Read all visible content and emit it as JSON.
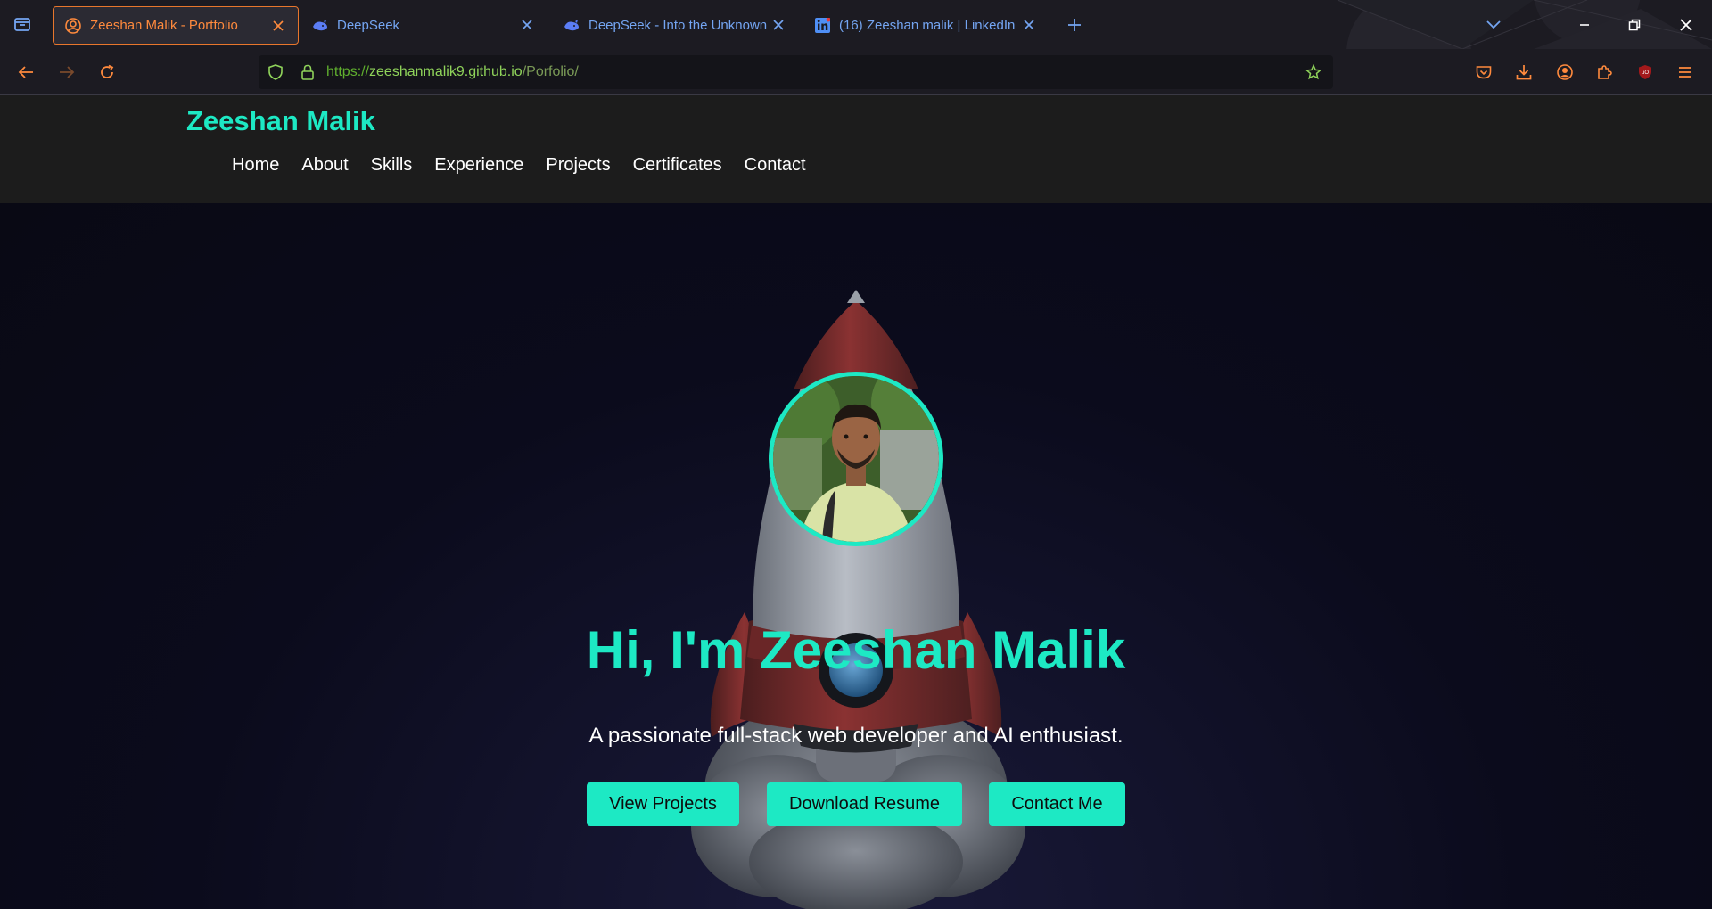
{
  "browser": {
    "tabs": [
      {
        "title": "Zeeshan Malik - Portfolio",
        "favicon": "user-circle-icon",
        "active": true
      },
      {
        "title": "DeepSeek",
        "favicon": "whale-icon",
        "active": false
      },
      {
        "title": "DeepSeek - Into the Unknown",
        "favicon": "whale-icon",
        "active": false
      },
      {
        "title": "(16) Zeeshan malik | LinkedIn",
        "favicon": "linkedin-icon",
        "active": false
      }
    ],
    "url": {
      "scheme": "https://",
      "host": "zeeshanmalik9.github.io",
      "path": "/Porfolio/"
    },
    "colors": {
      "chrome_bg": "#1c1b22",
      "active_tab_accent": "#ff8a3d",
      "tab_text": "#74a5f2"
    }
  },
  "site": {
    "brand": "Zeeshan Malik",
    "nav": [
      "Home",
      "About",
      "Skills",
      "Experience",
      "Projects",
      "Certificates",
      "Contact"
    ],
    "hero": {
      "title": "Hi, I'm Zeeshan Malik",
      "subtitle": "A passionate full-stack web developer and AI enthusiast.",
      "buttons": [
        "View Projects",
        "Download Resume",
        "Contact Me"
      ]
    },
    "colors": {
      "accent": "#1de9c4",
      "header_bg": "#1c1c1c",
      "page_bg": "#0b0b1a"
    }
  }
}
